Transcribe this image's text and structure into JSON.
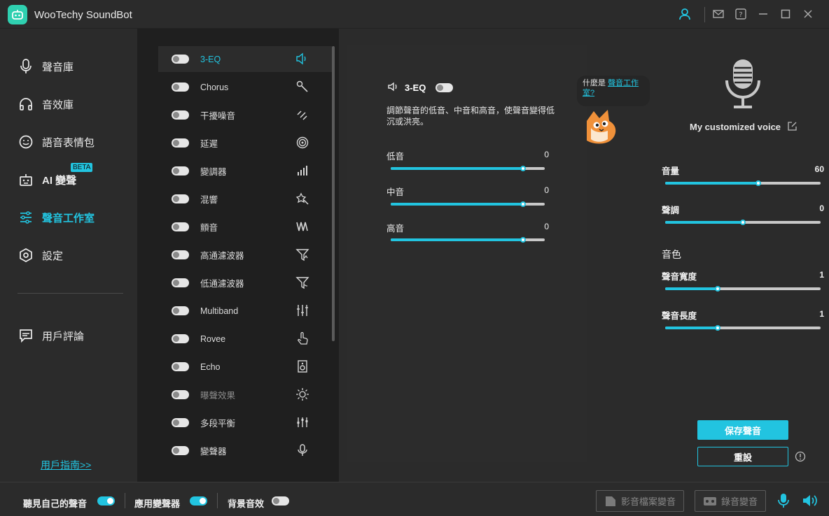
{
  "app": {
    "title": "WooTechy SoundBot",
    "accent": "#22c4e0"
  },
  "sidebar": {
    "items": [
      {
        "label": "聲音庫",
        "icon": "microphone-icon"
      },
      {
        "label": "音效庫",
        "icon": "headphones-icon"
      },
      {
        "label": "語音表情包",
        "icon": "smiley-icon"
      },
      {
        "label": "AI 變聲",
        "icon": "robot-icon",
        "badge": "BETA"
      },
      {
        "label": "聲音工作室",
        "icon": "sliders-icon",
        "active": true
      },
      {
        "label": "設定",
        "icon": "hexagon-settings-icon"
      },
      {
        "label": "用戶評論",
        "icon": "comment-icon"
      }
    ],
    "guide_link": "用戶指南>>"
  },
  "effects": [
    {
      "name": "3-EQ",
      "icon": "speaker-icon",
      "selected": true
    },
    {
      "name": "Chorus",
      "icon": "wand-icon"
    },
    {
      "name": "干擾噪音",
      "icon": "noise-icon"
    },
    {
      "name": "延遲",
      "icon": "delay-spiral-icon"
    },
    {
      "name": "變調器",
      "icon": "bars-icon"
    },
    {
      "name": "混響",
      "icon": "sparkle-wand-icon"
    },
    {
      "name": "顫音",
      "icon": "vibrato-icon"
    },
    {
      "name": "高通濾波器",
      "icon": "highpass-filter-icon"
    },
    {
      "name": "低通濾波器",
      "icon": "lowpass-filter-icon"
    },
    {
      "name": "Multiband",
      "icon": "multiband-icon"
    },
    {
      "name": "Rovee",
      "icon": "hand-pointer-icon"
    },
    {
      "name": "Echo",
      "icon": "speaker-box-icon"
    },
    {
      "name": "曝聲效果",
      "icon": "sun-icon",
      "dim": true
    },
    {
      "name": "多段平衡",
      "icon": "equalizer-icon"
    },
    {
      "name": "變聲器",
      "icon": "mic-small-icon"
    }
  ],
  "detail": {
    "title": "3-EQ",
    "description": "調節聲音的低音、中音和高音，使聲音變得低沉或洪亮。",
    "bands": [
      {
        "label": "低音",
        "value": "0",
        "level": 0.86
      },
      {
        "label": "中音",
        "value": "0",
        "level": 0.86
      },
      {
        "label": "高音",
        "value": "0",
        "level": 0.86
      }
    ]
  },
  "tooltip": {
    "prefix": "什麼是 ",
    "link": "聲音工作室?"
  },
  "voice_panel": {
    "voice_name": "My customized voice",
    "volume": {
      "label": "音量",
      "value": "60",
      "level": 0.6
    },
    "pitch": {
      "label": "聲調",
      "value": "0",
      "level": 0.5
    },
    "timbre_title": "音色",
    "width": {
      "label": "聲音寬度",
      "value": "1",
      "level": 0.34
    },
    "length": {
      "label": "聲音長度",
      "value": "1",
      "level": 0.34
    },
    "save_label": "保存聲音",
    "reset_label": "重設"
  },
  "bottom": {
    "hear_self_label": "聽見自己的聲音",
    "apply_changer_label": "應用變聲器",
    "bg_effect_label": "背景音效",
    "video_button": "影音檔案變音",
    "record_button": "錄音變音"
  }
}
